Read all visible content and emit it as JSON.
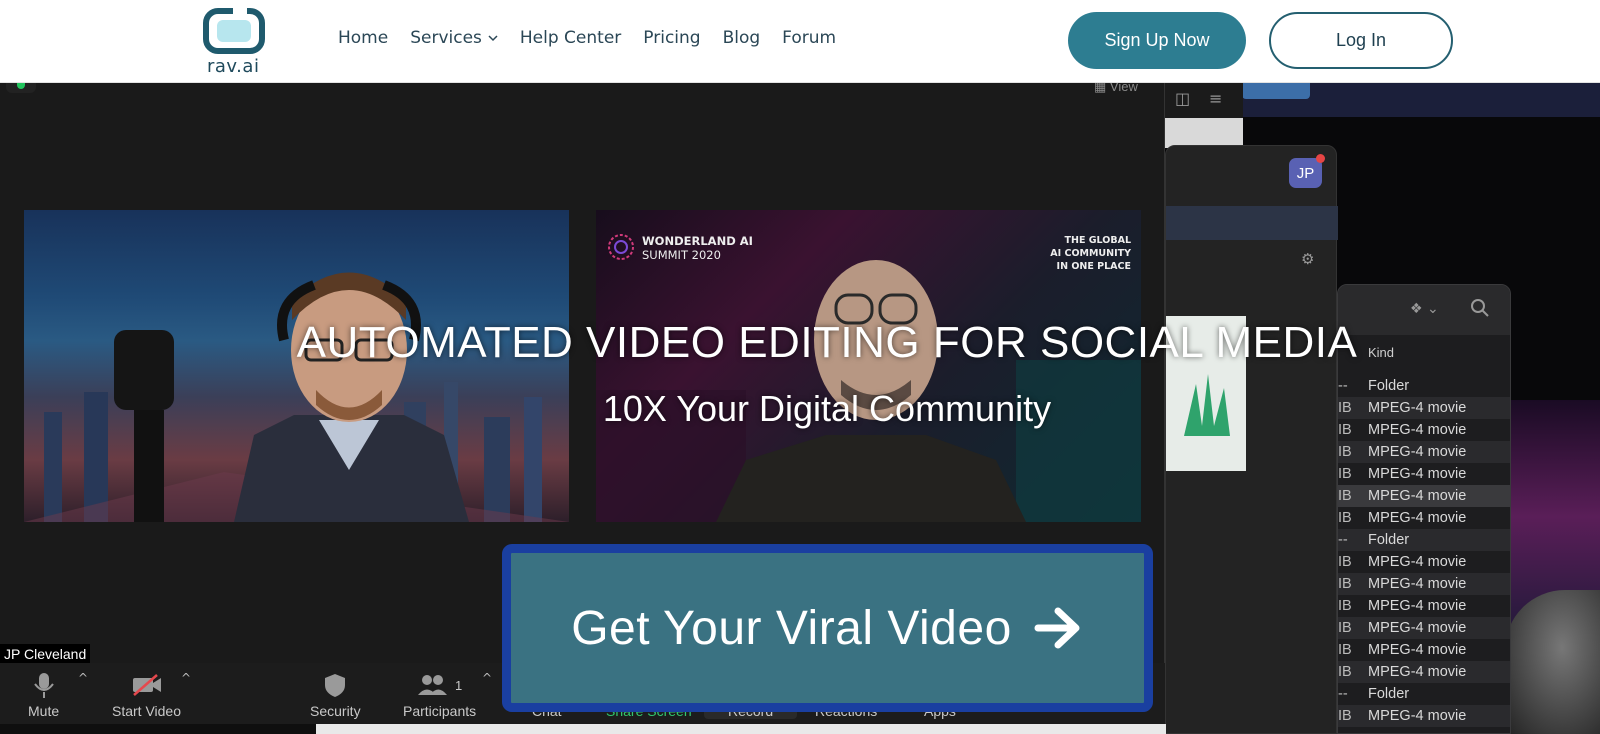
{
  "header": {
    "logo_text": "rav.ai",
    "nav": [
      {
        "label": "Home"
      },
      {
        "label": "Services"
      },
      {
        "label": "Help Center"
      },
      {
        "label": "Pricing"
      },
      {
        "label": "Blog"
      },
      {
        "label": "Forum"
      }
    ],
    "signup_label": "Sign Up Now",
    "login_label": "Log In"
  },
  "hero": {
    "title": "AUTOMATED VIDEO EDITING FOR SOCIAL MEDIA",
    "subtitle": "10X Your Digital Community",
    "cta_label": "Get Your Viral Video"
  },
  "zoom": {
    "view_label": "View",
    "participant_name": "JP Cleveland",
    "summit_title": "WONDERLAND AI",
    "summit_year": "SUMMIT 2020",
    "summit_tag_line1": "THE GLOBAL",
    "summit_tag_line2": "AI COMMUNITY",
    "summit_tag_line3": "IN ONE PLACE",
    "toolbar": {
      "mute": "Mute",
      "start_video": "Start Video",
      "security": "Security",
      "participants": "Participants",
      "participants_count": "1",
      "chat": "Chat",
      "share_screen": "Share Screen",
      "record": "Record",
      "reactions": "Reactions",
      "apps": "Apps"
    }
  },
  "chat_window": {
    "avatar_initials": "JP"
  },
  "finder": {
    "kind_header": "Kind",
    "rows": [
      {
        "size": "--",
        "kind": "Folder"
      },
      {
        "size": "IB",
        "kind": "MPEG-4 movie"
      },
      {
        "size": "IB",
        "kind": "MPEG-4 movie"
      },
      {
        "size": "IB",
        "kind": "MPEG-4 movie"
      },
      {
        "size": "IB",
        "kind": "MPEG-4 movie"
      },
      {
        "size": "IB",
        "kind": "MPEG-4 movie"
      },
      {
        "size": "IB",
        "kind": "MPEG-4 movie"
      },
      {
        "size": "--",
        "kind": "Folder"
      },
      {
        "size": "IB",
        "kind": "MPEG-4 movie"
      },
      {
        "size": "IB",
        "kind": "MPEG-4 movie"
      },
      {
        "size": "IB",
        "kind": "MPEG-4 movie"
      },
      {
        "size": "IB",
        "kind": "MPEG-4 movie"
      },
      {
        "size": "IB",
        "kind": "MPEG-4 movie"
      },
      {
        "size": "IB",
        "kind": "MPEG-4 movie"
      },
      {
        "size": "--",
        "kind": "Folder"
      },
      {
        "size": "IB",
        "kind": "MPEG-4 movie"
      }
    ]
  },
  "colors": {
    "brand": "#2d7d91",
    "cta_bg": "#3a7282",
    "cta_border": "#1a3fa0",
    "zoom_green": "#31c76e"
  }
}
